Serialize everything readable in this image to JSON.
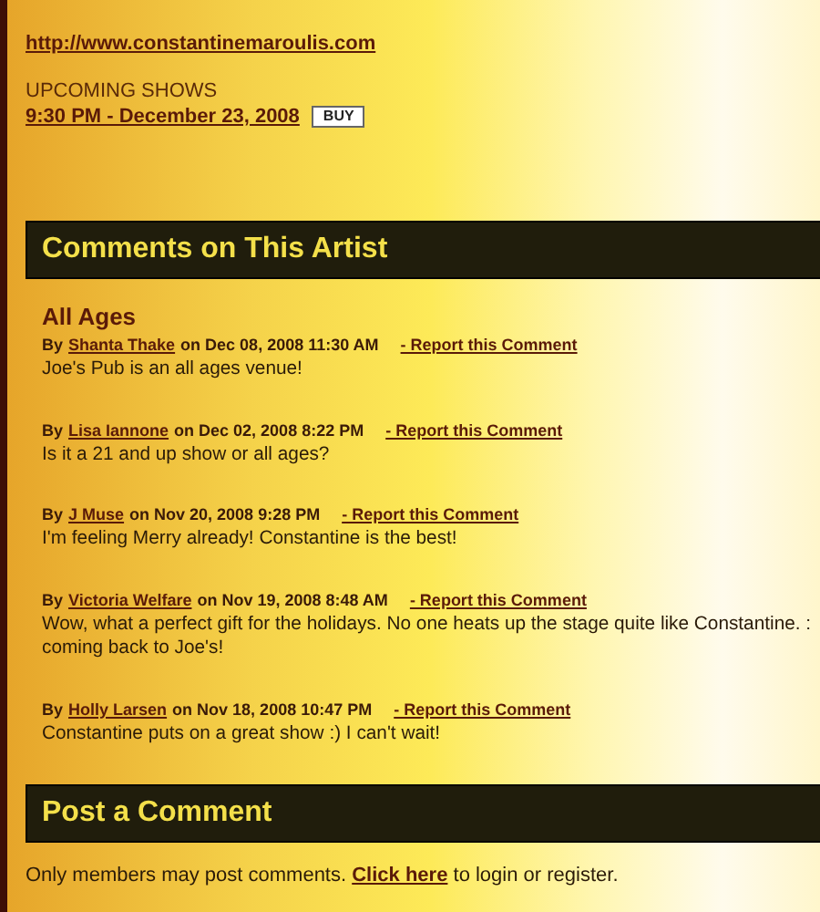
{
  "website_link": "http://www.constantinemaroulis.com",
  "upcoming": {
    "heading": "UPCOMING SHOWS",
    "show": "9:30 PM - December 23, 2008",
    "buy": "BUY"
  },
  "comments_section": {
    "title": "Comments on This Artist",
    "comments": [
      {
        "title": "All Ages",
        "by": "By",
        "author": "Shanta Thake",
        "date": "on Dec 08, 2008 11:30 AM",
        "report": "- Report this Comment",
        "lines": [
          "Joe's Pub is an all ages venue!"
        ]
      },
      {
        "by": "By",
        "author": "Lisa Iannone",
        "date": "on Dec 02, 2008 8:22 PM",
        "report": "- Report this Comment",
        "lines": [
          "Is it a 21 and up show or all ages?"
        ]
      },
      {
        "by": "By",
        "author": "J Muse",
        "date": "on Nov 20, 2008 9:28 PM",
        "report": "- Report this Comment",
        "lines": [
          "I'm feeling Merry already! Constantine is the best!"
        ]
      },
      {
        "by": "By",
        "author": "Victoria Welfare",
        "date": "on Nov 19, 2008 8:48 AM",
        "report": "- Report this Comment",
        "lines": [
          "Wow, what a perfect gift for the holidays. No one heats up the stage quite like Constantine. :",
          "coming back to Joe's!"
        ]
      },
      {
        "by": "By",
        "author": "Holly Larsen",
        "date": "on Nov 18, 2008 10:47 PM",
        "report": "- Report this Comment",
        "lines": [
          "Constantine puts on a great show :) I can't wait!"
        ]
      }
    ]
  },
  "post_section": {
    "title": "Post a Comment",
    "before": "Only members may post comments.",
    "link": "Click here",
    "after": "to login or register."
  }
}
